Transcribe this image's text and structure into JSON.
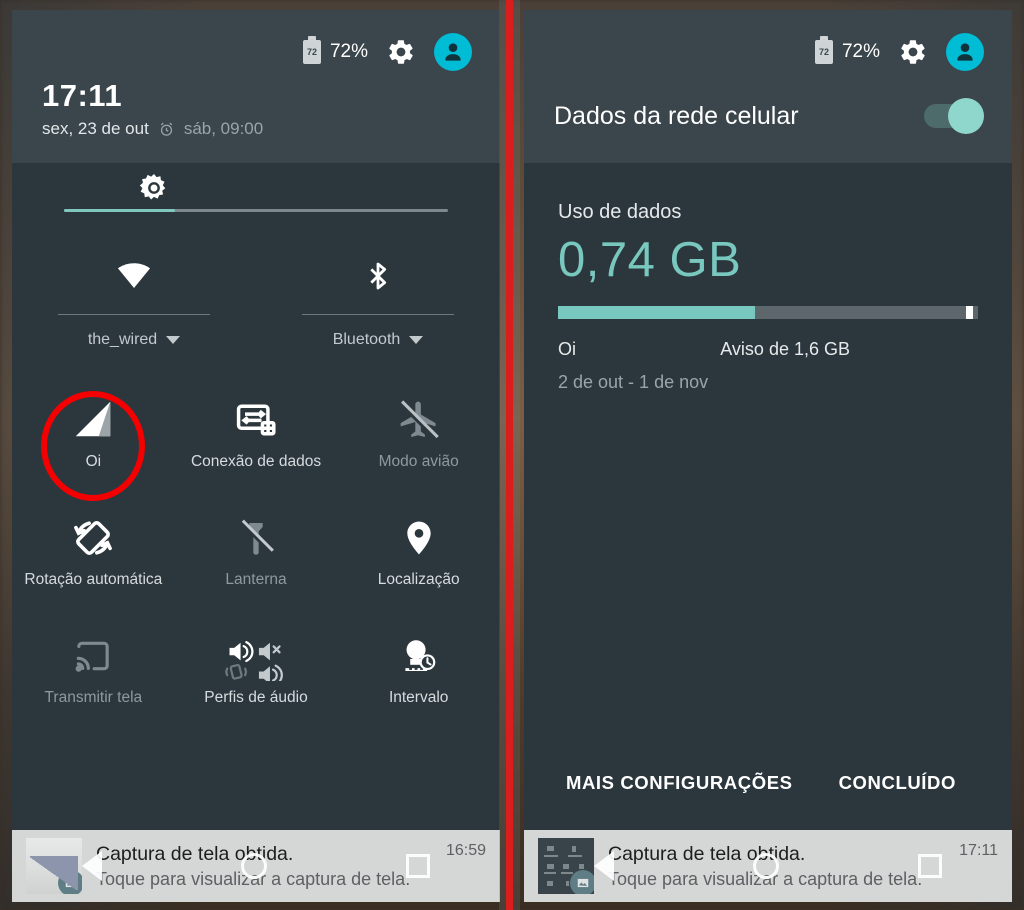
{
  "status_bar": {
    "battery_level_label": "72",
    "battery_percent": "72%",
    "battery_icon": "battery-icon",
    "settings_icon": "gear-icon",
    "avatar_icon": "user-avatar-icon"
  },
  "left_panel": {
    "clock": {
      "time": "17:11",
      "date": "sex, 23 de out",
      "alarm_icon": "alarm-clock-icon",
      "alarm_time": "sáb, 09:00"
    },
    "brightness": {
      "icon": "brightness-icon",
      "value_percent": 29
    },
    "top_tiles": [
      {
        "icon": "wifi-icon",
        "label": "the_wired",
        "caret": "chevron-down-icon"
      },
      {
        "icon": "bluetooth-icon",
        "label": "Bluetooth",
        "caret": "chevron-down-icon"
      }
    ],
    "tiles": [
      {
        "icon": "signal-bars-icon",
        "label": "Oi",
        "state": "on",
        "highlighted": true
      },
      {
        "icon": "data-connection-icon",
        "label": "Conexão de dados",
        "state": "on"
      },
      {
        "icon": "airplane-off-icon",
        "label": "Modo avião",
        "state": "off"
      },
      {
        "icon": "auto-rotate-icon",
        "label": "Rotação automática",
        "state": "on"
      },
      {
        "icon": "flashlight-off-icon",
        "label": "Lanterna",
        "state": "off"
      },
      {
        "icon": "location-pin-icon",
        "label": "Localização",
        "state": "on"
      },
      {
        "icon": "cast-screen-icon",
        "label": "Transmitir tela",
        "state": "off"
      },
      {
        "icon": "audio-profiles-icon",
        "label": "Perfis de áudio",
        "state": "on"
      },
      {
        "icon": "interval-bulb-icon",
        "label": "Intervalo",
        "state": "on"
      }
    ]
  },
  "right_panel": {
    "title": "Dados da rede celular",
    "toggle_state": "on",
    "data_usage": {
      "label": "Uso de dados",
      "amount": "0,74 GB",
      "carrier": "Oi",
      "warning": "Aviso de 1,6 GB",
      "period": "2 de out - 1 de nov",
      "bar_fill_percent": 47
    },
    "actions": {
      "more_settings": "MAIS CONFIGURAÇÕES",
      "done": "CONCLUÍDO"
    }
  },
  "notifications": [
    {
      "thumb": "screenshot-thumbnail",
      "title": "Captura de tela obtida.",
      "subtitle": "Toque para visualizar a captura de tela.",
      "time": "16:59"
    },
    {
      "thumb": "screenshot-thumbnail",
      "title": "Captura de tela obtida.",
      "subtitle": "Toque para visualizar a captura de tela.",
      "time": "17:11"
    }
  ],
  "nav_bar": {
    "back_icon": "back-triangle-icon",
    "home_icon": "home-circle-icon",
    "recents_icon": "recents-square-icon"
  },
  "annotation": {
    "type": "red-ellipse-highlight",
    "color": "#f40000",
    "target": "Oi"
  },
  "colors": {
    "panel_bg": "#2c373d",
    "header_bg": "#3a454c",
    "accent_teal": "#79c8bf",
    "avatar_cyan": "#00bcd4",
    "divider_red": "#fb0000",
    "notif_bg": "#d5d7d6"
  }
}
